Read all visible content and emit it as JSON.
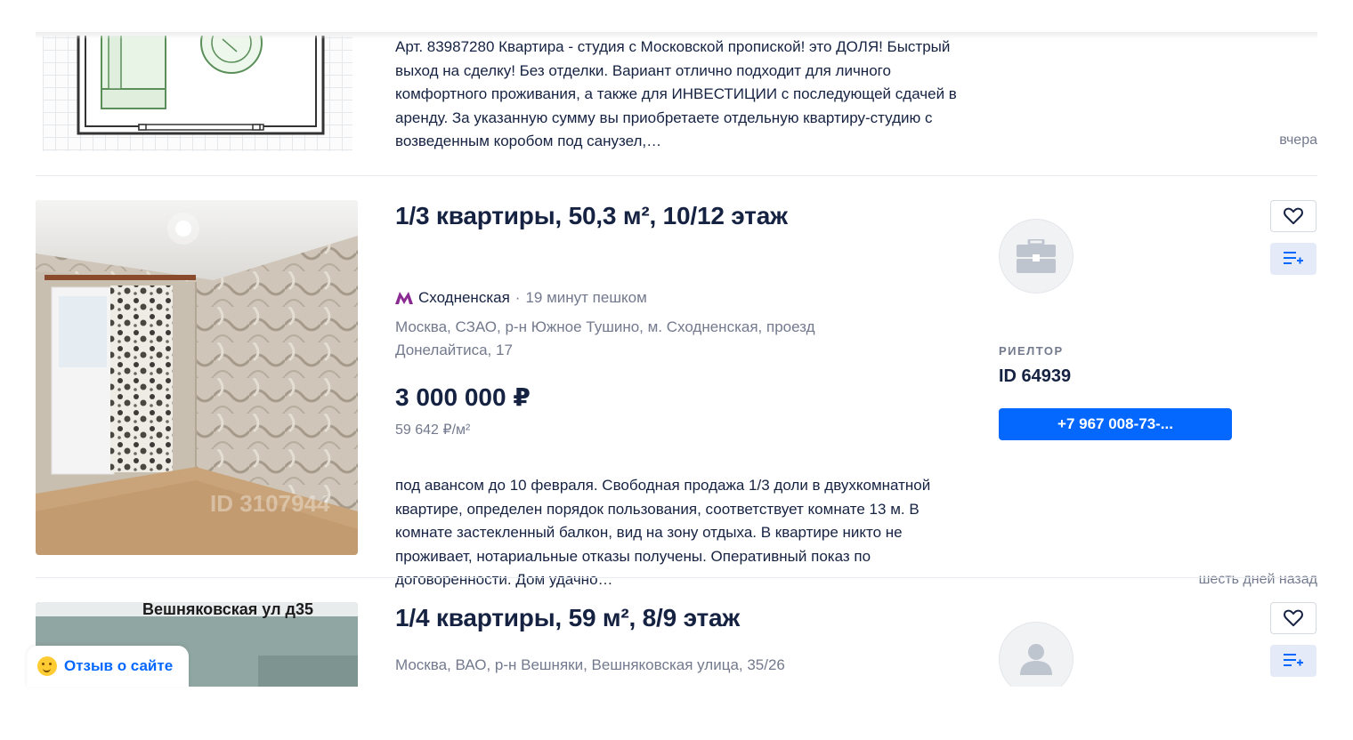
{
  "listings": [
    {
      "description": "Арт. 83987280 Квартира - студия с Московской пропиской! это ДОЛЯ! Быстрый выход на сделку! Без отделки. Вариант отлично подходит для личного комфортного проживания, а также для ИНВЕСТИЦИИ с последующей сдачей в аренду. За указанную сумму вы приобретаете отдельную квартиру-студию с возведенным коробом под санузел,…",
      "date": "вчера",
      "image": "floor-plan"
    },
    {
      "title": "1/3 квартиры, 50,3 м², 10/12 этаж",
      "metro_station": "Сходненская",
      "metro_walk": "19 минут пешком",
      "address": "Москва, СЗАО, р-н Южное Тушино, м. Сходненская, проезд Донелайтиса, 17",
      "price": "3 000 000 ₽",
      "price_per_sqm": "59 642 ₽/м²",
      "description": "под авансом до 10 февраля. Свободная продажа 1/3 доли в двухкомнатной квартире, определен порядок пользования, соответствует комнате 13 м. В комнате застекленный балкон, вид на зону отдыха. В квартире никто не проживает, нотариальные отказы получены. Оперативный показ по договоренности. Дом удачно…",
      "date": "шесть дней назад",
      "image": "room-photo",
      "watermark": "ID 3107944",
      "agent": {
        "role": "РИЕЛТОР",
        "id": "ID 64939",
        "phone": "+7 967 008-73-...",
        "avatar_icon": "briefcase-icon"
      }
    },
    {
      "title": "1/4 квартиры, 59 м², 8/9 этаж",
      "address": "Москва, ВАО, р-н Вешняки, Вешняковская улица, 35/26",
      "image": "building-photo",
      "image_text": "Вешняковская ул д35",
      "agent": {
        "avatar_icon": "person-icon"
      }
    }
  ],
  "feedback": {
    "label": "Отзыв о сайте",
    "icon": "smile-emoji-icon"
  },
  "icons": {
    "favorite": "heart-icon",
    "compare": "compare-list-icon",
    "metro": "metro-logo-icon"
  },
  "colors": {
    "accent": "#0468ff",
    "metro": "#8a2a92",
    "text": "#152242",
    "muted": "#737a8e"
  }
}
